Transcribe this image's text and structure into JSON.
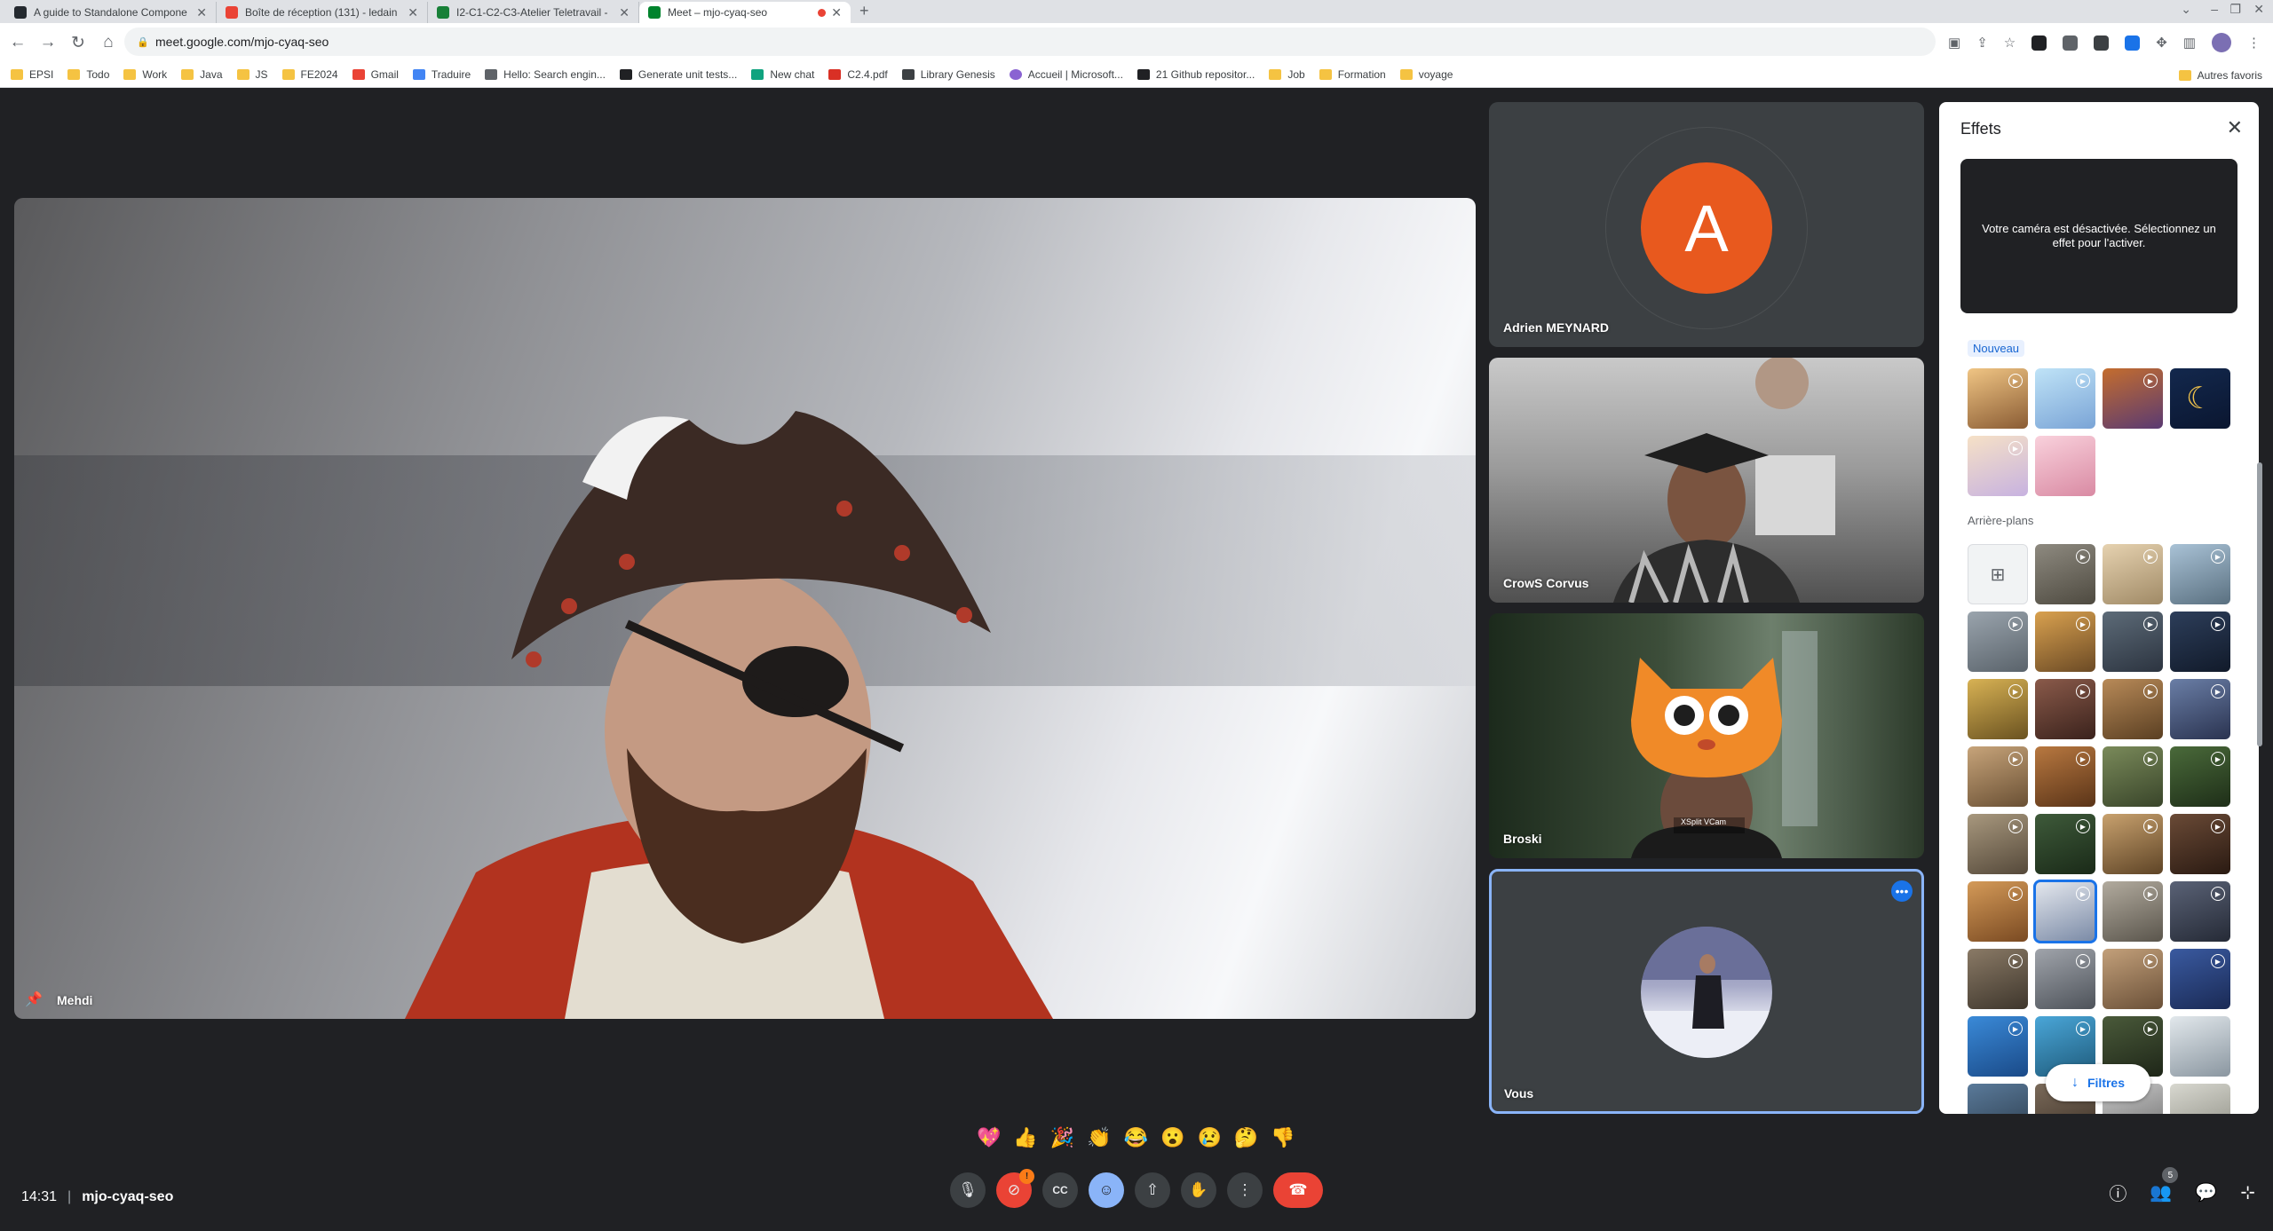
{
  "browser": {
    "tabs": [
      {
        "title": "A guide to Standalone Compone",
        "favicon_color": "#24292f",
        "active": false
      },
      {
        "title": "Boîte de réception (131) - ledain",
        "favicon_color": "#ea4335",
        "active": false
      },
      {
        "title": "I2-C1-C2-C3-Atelier Teletravail -",
        "favicon_color": "#188038",
        "active": false
      },
      {
        "title": "Meet – mjo-cyaq-seo",
        "favicon_color": "#00832d",
        "active": true
      }
    ],
    "new_tab_glyph": "+",
    "url": "meet.google.com/mjo-cyaq-seo",
    "bookmarks": [
      {
        "label": "EPSI",
        "icon": "folder-icon"
      },
      {
        "label": "Todo",
        "icon": "folder-icon"
      },
      {
        "label": "Work",
        "icon": "folder-icon"
      },
      {
        "label": "Java",
        "icon": "folder-icon"
      },
      {
        "label": "JS",
        "icon": "folder-icon"
      },
      {
        "label": "FE2024",
        "icon": "folder-icon"
      },
      {
        "label": "Gmail",
        "icon": "gmail-icon"
      },
      {
        "label": "Traduire",
        "icon": "translate-icon"
      },
      {
        "label": "Hello: Search engin...",
        "icon": "site-icon"
      },
      {
        "label": "Generate unit tests...",
        "icon": "site-icon"
      },
      {
        "label": "New chat",
        "icon": "chat-icon"
      },
      {
        "label": "C2.4.pdf",
        "icon": "pdf-icon"
      },
      {
        "label": "Library Genesis",
        "icon": "site-icon"
      },
      {
        "label": "Accueil | Microsoft...",
        "icon": "microsoft-icon"
      },
      {
        "label": "21 Github repositor...",
        "icon": "site-icon"
      },
      {
        "label": "Job",
        "icon": "folder-icon"
      },
      {
        "label": "Formation",
        "icon": "folder-icon"
      },
      {
        "label": "voyage",
        "icon": "folder-icon"
      }
    ],
    "other_bookmarks": "Autres favoris"
  },
  "meet": {
    "main_participant": "Mehdi",
    "participants": [
      {
        "name": "Adrien MEYNARD",
        "avatar_letter": "A",
        "avatar_color": "#e8591e"
      },
      {
        "name": "CrowS Corvus"
      },
      {
        "name": "Broski",
        "overlay_text": "XSplit VCam"
      },
      {
        "name": "Vous"
      }
    ],
    "effects_panel": {
      "title": "Effets",
      "camera_off_message": "Votre caméra est désactivée. Sélectionnez un effet pour l'activer.",
      "section_new": "Nouveau",
      "section_backgrounds": "Arrière-plans",
      "filters_button": "Filtres"
    },
    "reactions": [
      "💖",
      "👍",
      "🎉",
      "👏",
      "😂",
      "😮",
      "😢",
      "🤔",
      "👎"
    ],
    "time": "14:31",
    "meeting_code": "mjo-cyaq-seo",
    "camera_badge": "!",
    "people_count": "5",
    "colors": {
      "accent": "#1a73e8",
      "hangup": "#ea4335",
      "stage": "#202124",
      "tile": "#3c4043"
    }
  }
}
